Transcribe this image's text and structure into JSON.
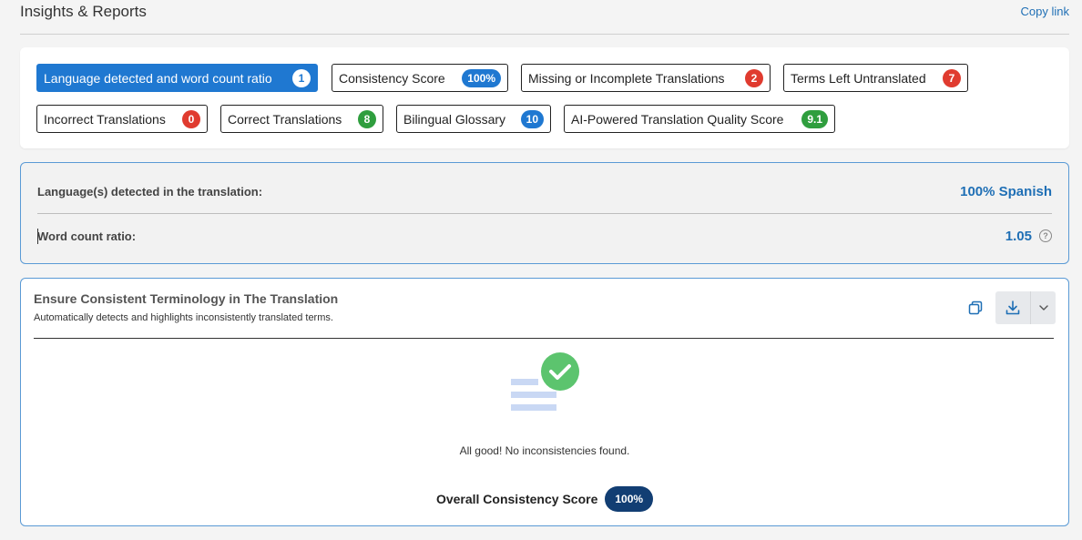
{
  "header": {
    "title": "Insights & Reports",
    "copy_link": "Copy link"
  },
  "tabs": [
    {
      "label": "Language detected and word count ratio",
      "badge": "1",
      "badge_color": "white",
      "active": true
    },
    {
      "label": "Consistency Score",
      "badge": "100%",
      "badge_color": "blue",
      "active": false
    },
    {
      "label": "Missing or Incomplete Translations",
      "badge": "2",
      "badge_color": "red",
      "active": false
    },
    {
      "label": "Terms Left Untranslated",
      "badge": "7",
      "badge_color": "red",
      "active": false
    },
    {
      "label": "Incorrect Translations",
      "badge": "0",
      "badge_color": "red",
      "active": false
    },
    {
      "label": "Correct Translations",
      "badge": "8",
      "badge_color": "green",
      "active": false
    },
    {
      "label": "Bilingual Glossary",
      "badge": "10",
      "badge_color": "blue",
      "active": false
    },
    {
      "label": "AI-Powered Translation Quality Score",
      "badge": "9.1",
      "badge_color": "green",
      "active": false
    }
  ],
  "language_panel": {
    "languages_label": "Language(s) detected in the translation:",
    "languages_value": "100% Spanish",
    "word_ratio_label": "Word count ratio:",
    "word_ratio_value": "1.05",
    "help_icon": "?"
  },
  "terminology": {
    "title": "Ensure Consistent Terminology in The Translation",
    "subtitle": "Automatically detects and highlights inconsistently translated terms.",
    "empty_message": "All good! No inconsistencies found.",
    "score_label": "Overall Consistency Score",
    "score_value": "100%"
  },
  "icons": {
    "copy": "copy-icon",
    "download": "download-icon",
    "dropdown": "chevron-down-icon",
    "check": "check-circle-icon"
  },
  "colors": {
    "accent": "#1f78d1",
    "link": "#1f6fb5",
    "red": "#e03b2f",
    "green": "#2f9e3e",
    "score_pill": "#123e73",
    "check_green": "#5cc46e"
  }
}
